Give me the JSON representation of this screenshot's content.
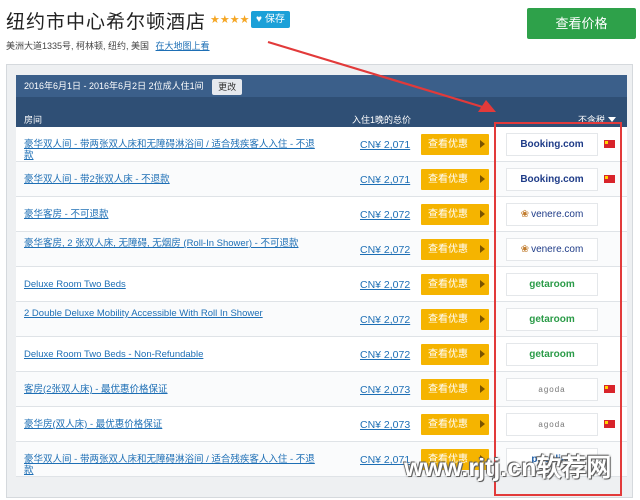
{
  "header": {
    "title": "纽约市中心希尔顿酒店",
    "stars": "★★★★",
    "save_label": "保存",
    "address": "美洲大道1335号, 柯林顿, 纽约, 美国",
    "map_link": "在大地图上看",
    "view_price_label": "查看价格"
  },
  "panel": {
    "date_text": "2016年6月1日 - 2016年6月2日  2位成人住1间",
    "change_label": "更改",
    "col_room": "房间",
    "col_price": "入住1晚的总价",
    "col_tax": "不含税"
  },
  "rows": [
    {
      "room": "豪华双人间 - 带两张双人床和无障碍淋浴间 / 适合残疾客人入住 - 不退款",
      "price": "CN¥ 2,071",
      "deal": "查看优惠",
      "logo": "Booking.com",
      "logo_type": "booking",
      "flag": true
    },
    {
      "room": "豪华双人间 - 带2张双人床 - 不退款",
      "price": "CN¥ 2,071",
      "deal": "查看优惠",
      "logo": "Booking.com",
      "logo_type": "booking",
      "flag": true
    },
    {
      "room": "豪华客房 - 不可退款",
      "price": "CN¥ 2,072",
      "deal": "查看优惠",
      "logo": "venere.com",
      "logo_type": "venere",
      "flag": false
    },
    {
      "room": "豪华客房, 2 张双人床, 无障碍, 无烟房 (Roll-In Shower) - 不可退款",
      "price": "CN¥ 2,072",
      "deal": "查看优惠",
      "logo": "venere.com",
      "logo_type": "venere",
      "flag": false
    },
    {
      "room": "Deluxe Room Two Beds",
      "price": "CN¥ 2,072",
      "deal": "查看优惠",
      "logo": "getaroom",
      "logo_type": "getaroom",
      "flag": false
    },
    {
      "room": "2 Double Deluxe Mobility Accessible With Roll In Shower",
      "price": "CN¥ 2,072",
      "deal": "查看优惠",
      "logo": "getaroom",
      "logo_type": "getaroom",
      "flag": false
    },
    {
      "room": "Deluxe Room Two Beds - Non-Refundable",
      "price": "CN¥ 2,072",
      "deal": "查看优惠",
      "logo": "getaroom",
      "logo_type": "getaroom",
      "flag": false
    },
    {
      "room": "客房(2张双人床) - 最优惠价格保证",
      "price": "CN¥ 2,073",
      "deal": "查看优惠",
      "logo": "agoda",
      "logo_type": "agoda",
      "flag": true
    },
    {
      "room": "豪华房(双人床) - 最优惠价格保证",
      "price": "CN¥ 2,073",
      "deal": "查看优惠",
      "logo": "agoda",
      "logo_type": "agoda",
      "flag": true
    },
    {
      "room": "豪华双人间 - 带两张双人床和无障碍淋浴间 / 适合残疾客人入住 - 不退款",
      "price": "CN¥ 2,071",
      "deal": "查看优惠",
      "logo": "priceline",
      "logo_type": "priceline",
      "flag": false
    }
  ],
  "watermark": "www.rjtj.cn软荐网",
  "colors": {
    "accent_green": "#2ea14a",
    "deal_yellow": "#f5b400",
    "link_blue": "#1e6fb5",
    "header_navy": "#2f4f75",
    "highlight_red": "#e23a3a"
  }
}
